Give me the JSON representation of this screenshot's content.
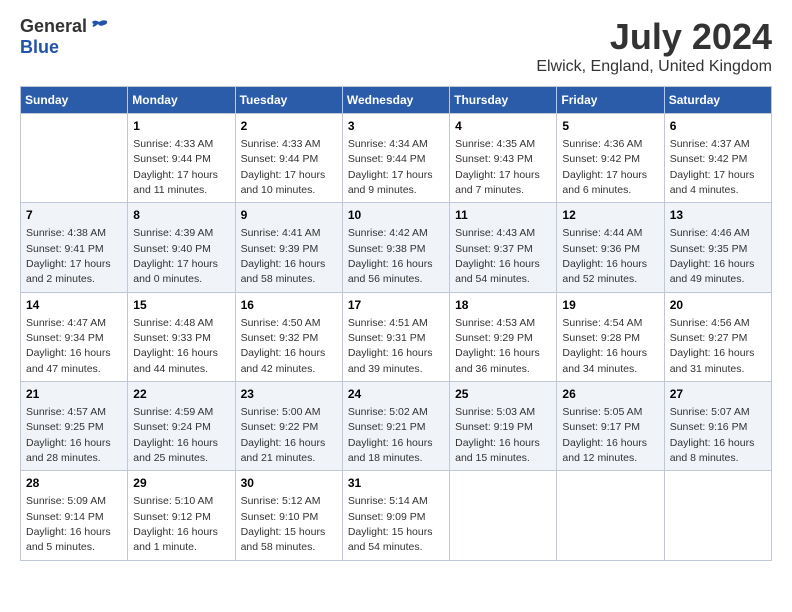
{
  "header": {
    "logo_general": "General",
    "logo_blue": "Blue",
    "month_title": "July 2024",
    "location": "Elwick, England, United Kingdom"
  },
  "days_of_week": [
    "Sunday",
    "Monday",
    "Tuesday",
    "Wednesday",
    "Thursday",
    "Friday",
    "Saturday"
  ],
  "weeks": [
    [
      {
        "day": "",
        "info": ""
      },
      {
        "day": "1",
        "info": "Sunrise: 4:33 AM\nSunset: 9:44 PM\nDaylight: 17 hours\nand 11 minutes."
      },
      {
        "day": "2",
        "info": "Sunrise: 4:33 AM\nSunset: 9:44 PM\nDaylight: 17 hours\nand 10 minutes."
      },
      {
        "day": "3",
        "info": "Sunrise: 4:34 AM\nSunset: 9:44 PM\nDaylight: 17 hours\nand 9 minutes."
      },
      {
        "day": "4",
        "info": "Sunrise: 4:35 AM\nSunset: 9:43 PM\nDaylight: 17 hours\nand 7 minutes."
      },
      {
        "day": "5",
        "info": "Sunrise: 4:36 AM\nSunset: 9:42 PM\nDaylight: 17 hours\nand 6 minutes."
      },
      {
        "day": "6",
        "info": "Sunrise: 4:37 AM\nSunset: 9:42 PM\nDaylight: 17 hours\nand 4 minutes."
      }
    ],
    [
      {
        "day": "7",
        "info": "Sunrise: 4:38 AM\nSunset: 9:41 PM\nDaylight: 17 hours\nand 2 minutes."
      },
      {
        "day": "8",
        "info": "Sunrise: 4:39 AM\nSunset: 9:40 PM\nDaylight: 17 hours\nand 0 minutes."
      },
      {
        "day": "9",
        "info": "Sunrise: 4:41 AM\nSunset: 9:39 PM\nDaylight: 16 hours\nand 58 minutes."
      },
      {
        "day": "10",
        "info": "Sunrise: 4:42 AM\nSunset: 9:38 PM\nDaylight: 16 hours\nand 56 minutes."
      },
      {
        "day": "11",
        "info": "Sunrise: 4:43 AM\nSunset: 9:37 PM\nDaylight: 16 hours\nand 54 minutes."
      },
      {
        "day": "12",
        "info": "Sunrise: 4:44 AM\nSunset: 9:36 PM\nDaylight: 16 hours\nand 52 minutes."
      },
      {
        "day": "13",
        "info": "Sunrise: 4:46 AM\nSunset: 9:35 PM\nDaylight: 16 hours\nand 49 minutes."
      }
    ],
    [
      {
        "day": "14",
        "info": "Sunrise: 4:47 AM\nSunset: 9:34 PM\nDaylight: 16 hours\nand 47 minutes."
      },
      {
        "day": "15",
        "info": "Sunrise: 4:48 AM\nSunset: 9:33 PM\nDaylight: 16 hours\nand 44 minutes."
      },
      {
        "day": "16",
        "info": "Sunrise: 4:50 AM\nSunset: 9:32 PM\nDaylight: 16 hours\nand 42 minutes."
      },
      {
        "day": "17",
        "info": "Sunrise: 4:51 AM\nSunset: 9:31 PM\nDaylight: 16 hours\nand 39 minutes."
      },
      {
        "day": "18",
        "info": "Sunrise: 4:53 AM\nSunset: 9:29 PM\nDaylight: 16 hours\nand 36 minutes."
      },
      {
        "day": "19",
        "info": "Sunrise: 4:54 AM\nSunset: 9:28 PM\nDaylight: 16 hours\nand 34 minutes."
      },
      {
        "day": "20",
        "info": "Sunrise: 4:56 AM\nSunset: 9:27 PM\nDaylight: 16 hours\nand 31 minutes."
      }
    ],
    [
      {
        "day": "21",
        "info": "Sunrise: 4:57 AM\nSunset: 9:25 PM\nDaylight: 16 hours\nand 28 minutes."
      },
      {
        "day": "22",
        "info": "Sunrise: 4:59 AM\nSunset: 9:24 PM\nDaylight: 16 hours\nand 25 minutes."
      },
      {
        "day": "23",
        "info": "Sunrise: 5:00 AM\nSunset: 9:22 PM\nDaylight: 16 hours\nand 21 minutes."
      },
      {
        "day": "24",
        "info": "Sunrise: 5:02 AM\nSunset: 9:21 PM\nDaylight: 16 hours\nand 18 minutes."
      },
      {
        "day": "25",
        "info": "Sunrise: 5:03 AM\nSunset: 9:19 PM\nDaylight: 16 hours\nand 15 minutes."
      },
      {
        "day": "26",
        "info": "Sunrise: 5:05 AM\nSunset: 9:17 PM\nDaylight: 16 hours\nand 12 minutes."
      },
      {
        "day": "27",
        "info": "Sunrise: 5:07 AM\nSunset: 9:16 PM\nDaylight: 16 hours\nand 8 minutes."
      }
    ],
    [
      {
        "day": "28",
        "info": "Sunrise: 5:09 AM\nSunset: 9:14 PM\nDaylight: 16 hours\nand 5 minutes."
      },
      {
        "day": "29",
        "info": "Sunrise: 5:10 AM\nSunset: 9:12 PM\nDaylight: 16 hours\nand 1 minute."
      },
      {
        "day": "30",
        "info": "Sunrise: 5:12 AM\nSunset: 9:10 PM\nDaylight: 15 hours\nand 58 minutes."
      },
      {
        "day": "31",
        "info": "Sunrise: 5:14 AM\nSunset: 9:09 PM\nDaylight: 15 hours\nand 54 minutes."
      },
      {
        "day": "",
        "info": ""
      },
      {
        "day": "",
        "info": ""
      },
      {
        "day": "",
        "info": ""
      }
    ]
  ]
}
